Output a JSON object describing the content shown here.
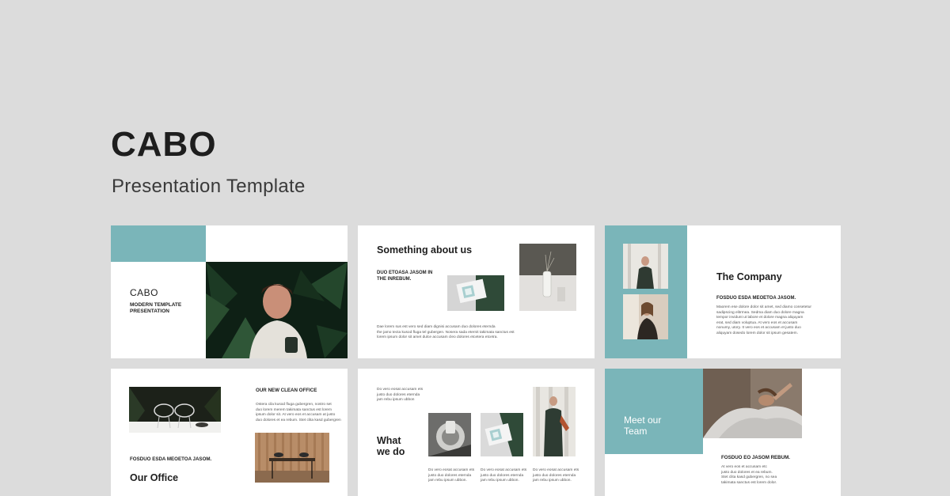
{
  "header": {
    "title": "CABO",
    "subtitle": "Presentation Template"
  },
  "slide1": {
    "brand": "CABO",
    "caption_line1": "MODERN TEMPLATE",
    "caption_line2": "PRESENTATION"
  },
  "slide2": {
    "heading": "Something about us",
    "caption_line1": "DUO ETOASA JASOM IN",
    "caption_line2": "THE INREBUM.",
    "body_line1": "Dae lorem sus est vero sed diam dignisi accusam duo dolores eternda",
    "body_line2": "the jamo tecta kusod fluga tel gubergen. Nosera sada eternit takimata sanctus est",
    "body_line3": "lorem ipsum dolor sit amet dulce accusam cleo dolores etcetera etcetra."
  },
  "slide3": {
    "heading": "The Company",
    "caption": "FOSDUO ESDA MEOETOA JASOM.",
    "body_line1": "Maorem ese dolore dolor sit amet, sed diamo consetetur",
    "body_line2": "sadipscing elitrmea. Sedma diam duo dolore magna",
    "body_line3": "tempor invidunt ut labore et dolore magna aliquyam",
    "body_line4": "erat, sed diam voluptua. At vero eos et accusam",
    "body_line5": "nonumy, utory. It vero eos et accusam et justo duo",
    "body_line6": "aliquyam dosedo lorem dolor sit ipsum gesatem."
  },
  "slide4": {
    "side_heading": "OUR NEW CLEAN OFFICE",
    "side_line1": "Ostera cila kusod fluga gubergren, nostro set",
    "side_line2": "duo lorem merem takimata sanctus est lorem",
    "side_line3": "ipsum dolor sit. At vero eos et accusam at justo",
    "side_line4": "duo dolores et ea rebum. Stet clita kasd gubergren",
    "caption": "FOSDUO ESDA MEOETOA JASOM.",
    "heading": "Our Office"
  },
  "slide5": {
    "top_line1": "Do vero eosat accusam ets",
    "top_line2": "justo duo dolores eternda",
    "top_line3": "jam rebu ipsum ubbon",
    "heading_line1": "What",
    "heading_line2": "we do",
    "col1_line1": "Do vero eosat accusam ets",
    "col1_line2": "justo duo dolores eternda",
    "col1_line3": "jam rebu ipsum ubbon.",
    "col2_line1": "Do vero eosat accusam ets",
    "col2_line2": "justo duo dolores eternda",
    "col2_line3": "jam rebu ipsum ubbon.",
    "col3_line1": "Do vero eosat accusam ets",
    "col3_line2": "justo duo dolores eternda",
    "col3_line3": "jam rebu ipsum ubbon."
  },
  "slide6": {
    "heading_line1": "Meet our",
    "heading_line2": "Team",
    "caption": "FOSDUO EO JASOM REBUM.",
    "body_line1": "At vero eos et accusam etc",
    "body_line2": "justo duo dolores et ea rebum.",
    "body_line3": "Stet clita kasd gubergren, no sea",
    "body_line4": "takimata sanctus est lorem dolor."
  },
  "colors": {
    "accent": "#7ab5b9",
    "background": "#dcdcdc",
    "dark": "#1e1e1e"
  }
}
